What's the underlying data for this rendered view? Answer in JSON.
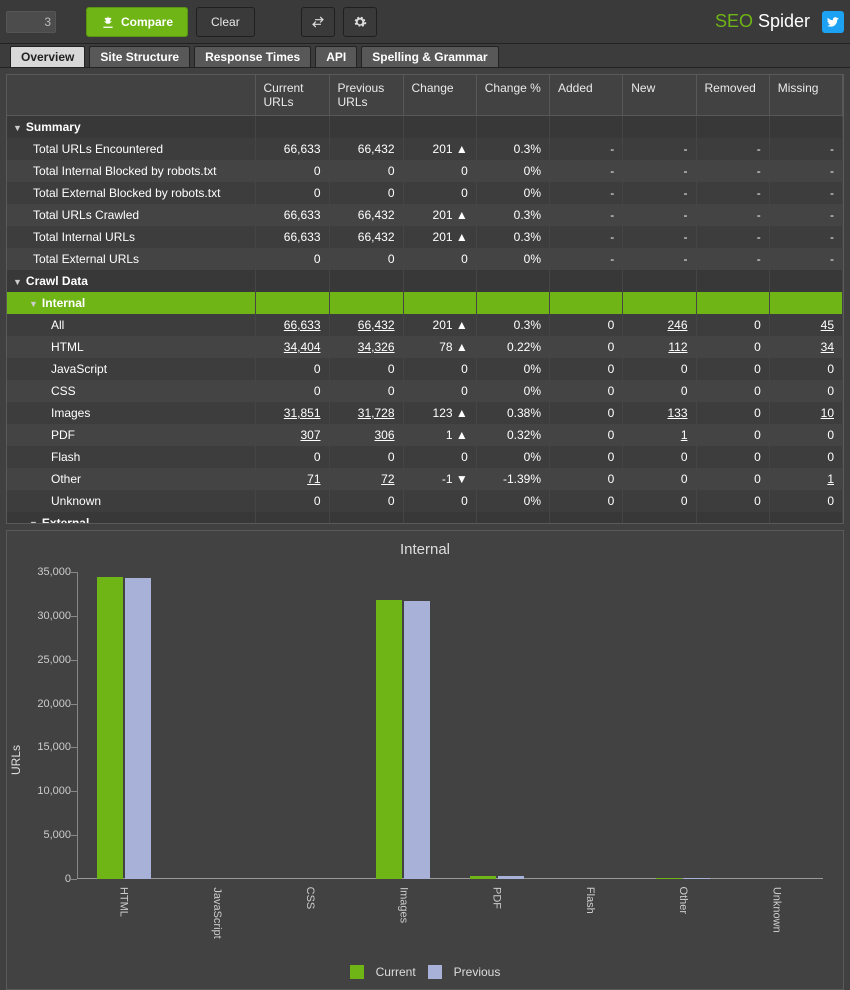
{
  "topbar": {
    "stub": "3",
    "compare": "Compare",
    "clear": "Clear",
    "brand_a": "SEO",
    "brand_b": " Spider"
  },
  "tabs": [
    "Overview",
    "Site Structure",
    "Response Times",
    "API",
    "Spelling & Grammar"
  ],
  "active_tab": 0,
  "columns": {
    "name": "",
    "current": "Current URLs",
    "previous": "Previous URLs",
    "change": "Change",
    "changepct": "Change %",
    "added": "Added",
    "new": "New",
    "removed": "Removed",
    "missing": "Missing"
  },
  "groups": [
    {
      "label": "Summary",
      "rows": [
        {
          "name": "Total URLs Encountered",
          "cur": "66,633",
          "prev": "66,432",
          "chg": "201 ▲",
          "pct": "0.3%",
          "added": "-",
          "new": "-",
          "rem": "-",
          "miss": "-",
          "pos": true
        },
        {
          "name": "Total Internal Blocked by robots.txt",
          "cur": "0",
          "prev": "0",
          "chg": "0",
          "pct": "0%",
          "added": "-",
          "new": "-",
          "rem": "-",
          "miss": "-"
        },
        {
          "name": "Total External Blocked by robots.txt",
          "cur": "0",
          "prev": "0",
          "chg": "0",
          "pct": "0%",
          "added": "-",
          "new": "-",
          "rem": "-",
          "miss": "-"
        },
        {
          "name": "Total URLs Crawled",
          "cur": "66,633",
          "prev": "66,432",
          "chg": "201 ▲",
          "pct": "0.3%",
          "added": "-",
          "new": "-",
          "rem": "-",
          "miss": "-",
          "pos": true
        },
        {
          "name": "Total Internal URLs",
          "cur": "66,633",
          "prev": "66,432",
          "chg": "201 ▲",
          "pct": "0.3%",
          "added": "-",
          "new": "-",
          "rem": "-",
          "miss": "-",
          "pos": true
        },
        {
          "name": "Total External URLs",
          "cur": "0",
          "prev": "0",
          "chg": "0",
          "pct": "0%",
          "added": "-",
          "new": "-",
          "rem": "-",
          "miss": "-"
        }
      ]
    },
    {
      "label": "Crawl Data",
      "sub": {
        "label": "Internal",
        "selected": true,
        "rows": [
          {
            "name": "All",
            "cur": "66,633",
            "prev": "66,432",
            "chg": "201 ▲",
            "pct": "0.3%",
            "added": "0",
            "new": "246",
            "rem": "0",
            "miss": "45",
            "pos": true,
            "u": true
          },
          {
            "name": "HTML",
            "cur": "34,404",
            "prev": "34,326",
            "chg": "78 ▲",
            "pct": "0.22%",
            "added": "0",
            "new": "112",
            "rem": "0",
            "miss": "34",
            "pos": true,
            "u": true
          },
          {
            "name": "JavaScript",
            "cur": "0",
            "prev": "0",
            "chg": "0",
            "pct": "0%",
            "added": "0",
            "new": "0",
            "rem": "0",
            "miss": "0"
          },
          {
            "name": "CSS",
            "cur": "0",
            "prev": "0",
            "chg": "0",
            "pct": "0%",
            "added": "0",
            "new": "0",
            "rem": "0",
            "miss": "0"
          },
          {
            "name": "Images",
            "cur": "31,851",
            "prev": "31,728",
            "chg": "123 ▲",
            "pct": "0.38%",
            "added": "0",
            "new": "133",
            "rem": "0",
            "miss": "10",
            "pos": true,
            "u": true
          },
          {
            "name": "PDF",
            "cur": "307",
            "prev": "306",
            "chg": "1 ▲",
            "pct": "0.32%",
            "added": "0",
            "new": "1",
            "rem": "0",
            "miss": "0",
            "pos": true,
            "u": true
          },
          {
            "name": "Flash",
            "cur": "0",
            "prev": "0",
            "chg": "0",
            "pct": "0%",
            "added": "0",
            "new": "0",
            "rem": "0",
            "miss": "0"
          },
          {
            "name": "Other",
            "cur": "71",
            "prev": "72",
            "chg": "-1 ▼",
            "pct": "-1.39%",
            "added": "0",
            "new": "0",
            "rem": "0",
            "miss": "1",
            "neg": true,
            "u": true
          },
          {
            "name": "Unknown",
            "cur": "0",
            "prev": "0",
            "chg": "0",
            "pct": "0%",
            "added": "0",
            "new": "0",
            "rem": "0",
            "miss": "0"
          }
        ]
      },
      "sub2": {
        "label": "External"
      }
    }
  ],
  "chart": {
    "title": "Internal",
    "ylabel": "URLs",
    "legend": {
      "cur": "Current",
      "prev": "Previous"
    }
  },
  "chart_data": {
    "type": "bar",
    "title": "Internal",
    "ylabel": "URLs",
    "ylim": [
      0,
      35000
    ],
    "yticks": [
      0,
      5000,
      10000,
      15000,
      20000,
      25000,
      30000,
      35000
    ],
    "categories": [
      "HTML",
      "JavaScript",
      "CSS",
      "Images",
      "PDF",
      "Flash",
      "Other",
      "Unknown"
    ],
    "series": [
      {
        "name": "Current",
        "color": "#6fb516",
        "values": [
          34404,
          0,
          0,
          31851,
          307,
          0,
          71,
          0
        ]
      },
      {
        "name": "Previous",
        "color": "#a8b2d8",
        "values": [
          34326,
          0,
          0,
          31728,
          306,
          0,
          72,
          0
        ]
      }
    ]
  }
}
